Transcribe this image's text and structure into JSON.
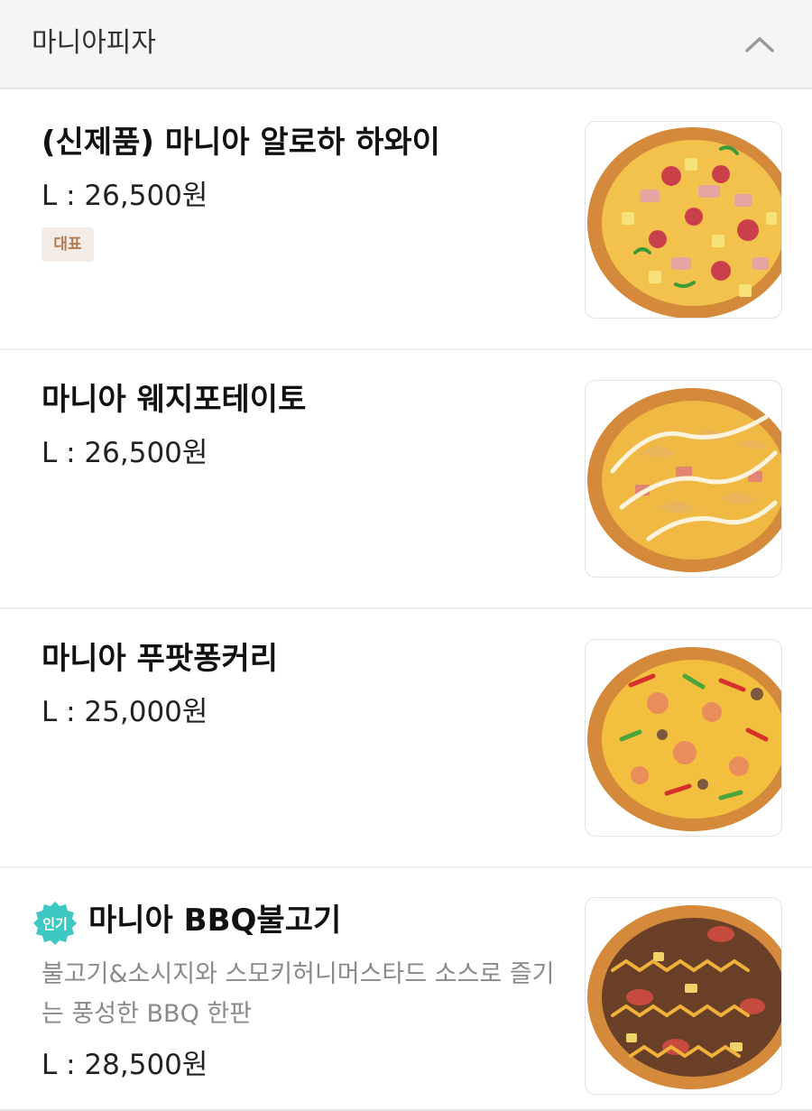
{
  "section": {
    "title": "마니아피자",
    "toggle_icon": "chevron-up-icon"
  },
  "items": [
    {
      "name": "(신제품) 마니아 알로하 하와이",
      "price": "L : 26,500원",
      "badge": "대표",
      "image_icon": "pizza-hawaiian-image"
    },
    {
      "name": "마니아 웨지포테이토",
      "price": "L : 26,500원",
      "image_icon": "pizza-wedge-potato-image"
    },
    {
      "name": "마니아 푸팟퐁커리",
      "price": "L : 25,000원",
      "image_icon": "pizza-curry-image"
    },
    {
      "name": "마니아 BBQ불고기",
      "badge": "인기",
      "description": "불고기&소시지와 스모키허니머스타드 소스로 즐기는 풍성한 BBQ 한판",
      "price": "L : 28,500원",
      "image_icon": "pizza-bbq-bulgogi-image"
    }
  ],
  "colors": {
    "header_bg": "#f5f5f5",
    "badge_rep_bg": "#f3ece6",
    "badge_rep_text": "#b07a52",
    "badge_popular": "#3ec8c3",
    "crust": "#d9913f",
    "text_primary": "#111111",
    "text_secondary": "#8a8a8a"
  }
}
